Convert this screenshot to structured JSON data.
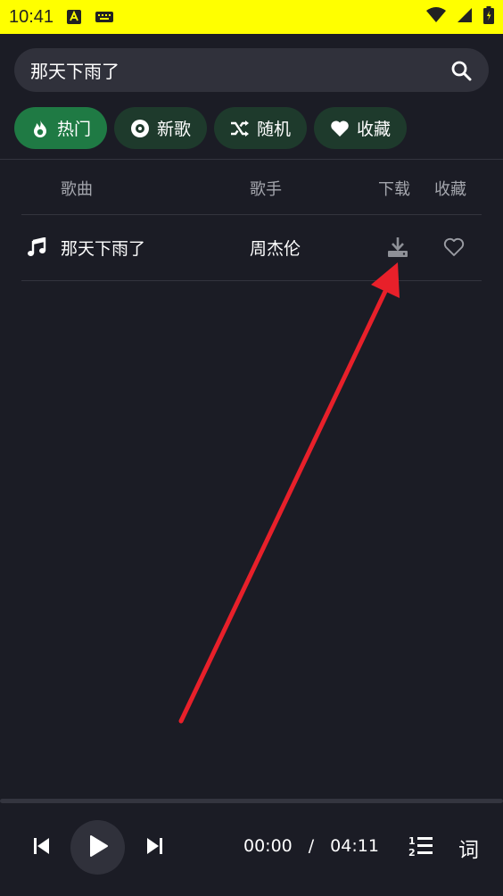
{
  "status": {
    "time": "10:41"
  },
  "search": {
    "query": "那天下雨了"
  },
  "chips": [
    {
      "label": "热门",
      "icon": "flame-icon"
    },
    {
      "label": "新歌",
      "icon": "disc-icon"
    },
    {
      "label": "随机",
      "icon": "shuffle-icon"
    },
    {
      "label": "收藏",
      "icon": "heart-icon"
    }
  ],
  "table": {
    "headers": {
      "song": "歌曲",
      "artist": "歌手",
      "download": "下载",
      "favorite": "收藏"
    },
    "rows": [
      {
        "title": "那天下雨了",
        "artist": "周杰伦"
      }
    ]
  },
  "player": {
    "current": "00:00",
    "separator": "/",
    "total": "04:11",
    "lyrics_label": "词"
  },
  "colors": {
    "accent": "#1f7a44",
    "chip": "#1e3a2c",
    "background": "#1b1c25",
    "statusbar": "#ffff00",
    "annotation": "#e8202a"
  }
}
